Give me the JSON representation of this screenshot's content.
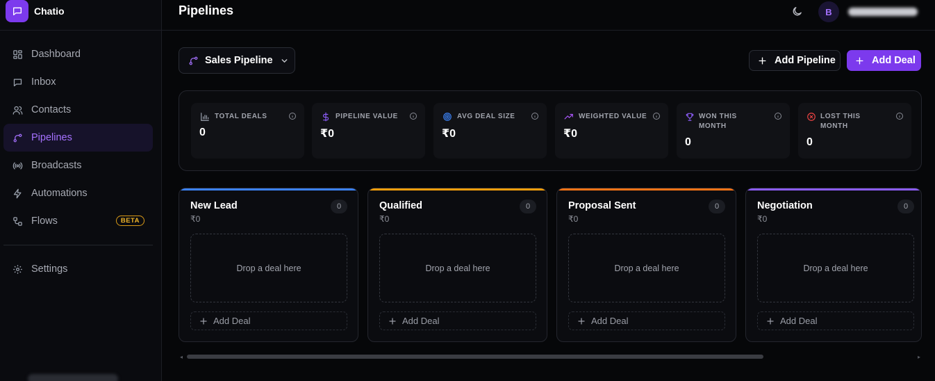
{
  "app": {
    "name": "Chatio",
    "accent": "#7c3aed"
  },
  "sidebar": {
    "items": [
      {
        "label": "Dashboard",
        "icon": "dashboard-icon",
        "active": false
      },
      {
        "label": "Inbox",
        "icon": "inbox-icon",
        "active": false
      },
      {
        "label": "Contacts",
        "icon": "contacts-icon",
        "active": false
      },
      {
        "label": "Pipelines",
        "icon": "pipelines-icon",
        "active": true
      },
      {
        "label": "Broadcasts",
        "icon": "broadcast-icon",
        "active": false
      },
      {
        "label": "Automations",
        "icon": "lightning-icon",
        "active": false
      },
      {
        "label": "Flows",
        "icon": "flows-icon",
        "active": false,
        "badge": "BETA"
      }
    ],
    "settings": {
      "label": "Settings",
      "icon": "gear-icon"
    }
  },
  "header": {
    "title": "Pipelines",
    "avatar_initial": "B"
  },
  "toolbar": {
    "pipeline_select": "Sales Pipeline",
    "add_pipeline": "Add Pipeline",
    "add_deal": "Add Deal"
  },
  "stats": [
    {
      "label": "TOTAL DEALS",
      "value": "0",
      "icon": "bar-chart-icon",
      "icon_color": "#9ca3af"
    },
    {
      "label": "PIPELINE VALUE",
      "value": "₹0",
      "icon": "dollar-icon",
      "icon_color": "#8b5cf6"
    },
    {
      "label": "AVG DEAL SIZE",
      "value": "₹0",
      "icon": "target-icon",
      "icon_color": "#3b82f6"
    },
    {
      "label": "WEIGHTED VALUE",
      "value": "₹0",
      "icon": "trending-up-icon",
      "icon_color": "#a855f7"
    },
    {
      "label": "WON THIS MONTH",
      "value": "0",
      "icon": "trophy-icon",
      "icon_color": "#8b5cf6"
    },
    {
      "label": "LOST THIS MONTH",
      "value": "0",
      "icon": "x-circle-icon",
      "icon_color": "#ef4444"
    }
  ],
  "columns": [
    {
      "title": "New Lead",
      "count": "0",
      "value": "₹0",
      "color": "#3b82f6",
      "drop_text": "Drop a deal here",
      "add_label": "Add Deal"
    },
    {
      "title": "Qualified",
      "count": "0",
      "value": "₹0",
      "color": "#f59e0b",
      "drop_text": "Drop a deal here",
      "add_label": "Add Deal"
    },
    {
      "title": "Proposal Sent",
      "count": "0",
      "value": "₹0",
      "color": "#f97316",
      "drop_text": "Drop a deal here",
      "add_label": "Add Deal"
    },
    {
      "title": "Negotiation",
      "count": "0",
      "value": "₹0",
      "color": "#8b5cf6",
      "drop_text": "Drop a deal here",
      "add_label": "Add Deal"
    }
  ]
}
